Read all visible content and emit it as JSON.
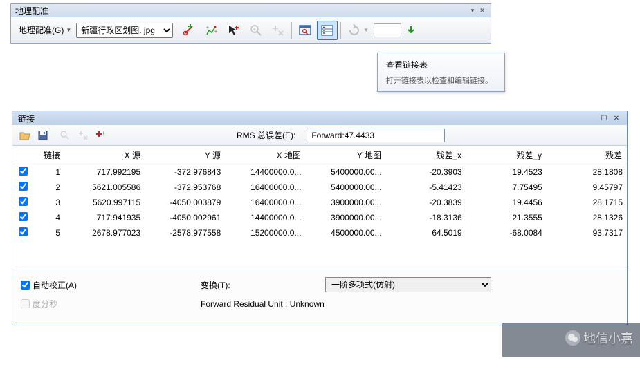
{
  "geo": {
    "title": "地理配准",
    "menu_label": "地理配准(G)",
    "image_select": "新疆行政区划图. jpg",
    "tooltip": {
      "title": "查看链接表",
      "body": "打开链接表以检查和编辑链接。"
    }
  },
  "links": {
    "title": "链接",
    "rms_label": "RMS 总误差(E):",
    "rms_value": "Forward:47.4433",
    "headers": {
      "chk": "",
      "link": "链接",
      "xsrc": "X 源",
      "ysrc": "Y 源",
      "xmap": "X 地图",
      "ymap": "Y 地图",
      "resx": "残差_x",
      "resy": "残差_y",
      "res": "残差"
    },
    "rows": [
      {
        "id": "1",
        "xsrc": "717.992195",
        "ysrc": "-372.976843",
        "xmap": "14400000.0...",
        "ymap": "5400000.00...",
        "resx": "-20.3903",
        "resy": "19.4523",
        "res": "28.1808"
      },
      {
        "id": "2",
        "xsrc": "5621.005586",
        "ysrc": "-372.953768",
        "xmap": "16400000.0...",
        "ymap": "5400000.00...",
        "resx": "-5.41423",
        "resy": "7.75495",
        "res": "9.45797"
      },
      {
        "id": "3",
        "xsrc": "5620.997115",
        "ysrc": "-4050.003879",
        "xmap": "16400000.0...",
        "ymap": "3900000.00...",
        "resx": "-20.3839",
        "resy": "19.4456",
        "res": "28.1715"
      },
      {
        "id": "4",
        "xsrc": "717.941935",
        "ysrc": "-4050.002961",
        "xmap": "14400000.0...",
        "ymap": "3900000.00...",
        "resx": "-18.3136",
        "resy": "21.3555",
        "res": "28.1326"
      },
      {
        "id": "5",
        "xsrc": "2678.977023",
        "ysrc": "-2578.977558",
        "xmap": "15200000.0...",
        "ymap": "4500000.00...",
        "resx": "64.5019",
        "resy": "-68.0084",
        "res": "93.7317"
      }
    ],
    "auto_rectify": "自动校正(A)",
    "transform_label": "变换(T):",
    "transform_value": "一阶多项式(仿射)",
    "dms": "度分秒",
    "residual_unit": "Forward Residual Unit : Unknown"
  },
  "watermark": "地信小嘉"
}
